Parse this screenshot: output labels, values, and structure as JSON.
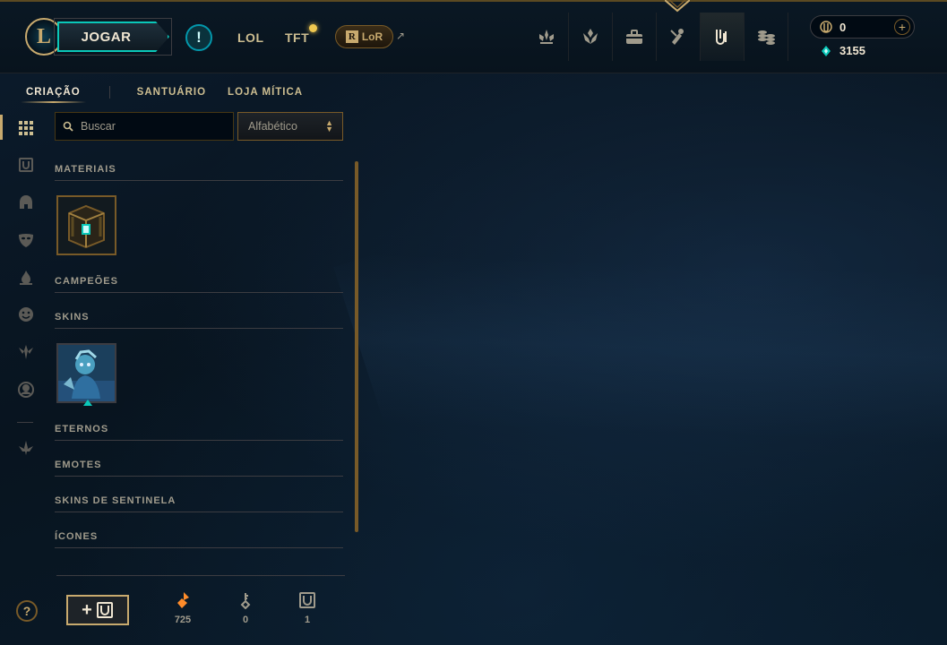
{
  "header": {
    "logo_letter": "L",
    "play_label": "JOGAR",
    "alert_glyph": "!",
    "modes": [
      "LOL",
      "TFT"
    ],
    "lor_label": "LoR",
    "lor_letter": "R",
    "external_glyph": "↗",
    "nav_icons": [
      "missions-icon",
      "profile-icon",
      "collection-icon",
      "loot-icon",
      "crafting-icon",
      "store-icon"
    ],
    "active_nav": "crafting-icon"
  },
  "currency": {
    "rp": "0",
    "plus": "+",
    "blue_essence": "3155"
  },
  "subnav": {
    "items": [
      "CRIAÇÃO",
      "SANTUÁRIO",
      "LOJA MÍTICA"
    ],
    "active": "CRIAÇÃO"
  },
  "rail": {
    "items": [
      "grid-icon",
      "chest-icon",
      "helmet-icon",
      "mask-icon",
      "flame-icon",
      "emote-icon",
      "ward-icon",
      "profile-icon",
      "arrow-down-icon"
    ]
  },
  "filters": {
    "search_placeholder": "Buscar",
    "sort_value": "Alfabético"
  },
  "categories": {
    "materials": "MATERIAIS",
    "champions": "CAMPEÕES",
    "skins": "SKINS",
    "eternals": "ETERNOS",
    "emotes": "EMOTES",
    "ward_skins": "SKINS DE SENTINELA",
    "icons": "ÍCONES"
  },
  "footer": {
    "help_glyph": "?",
    "add_glyph": "+",
    "orange_essence": "725",
    "keys": "0",
    "chests": "1"
  },
  "colors": {
    "gold": "#c8aa6e",
    "teal": "#0ac8b9",
    "background": "#010a13"
  }
}
